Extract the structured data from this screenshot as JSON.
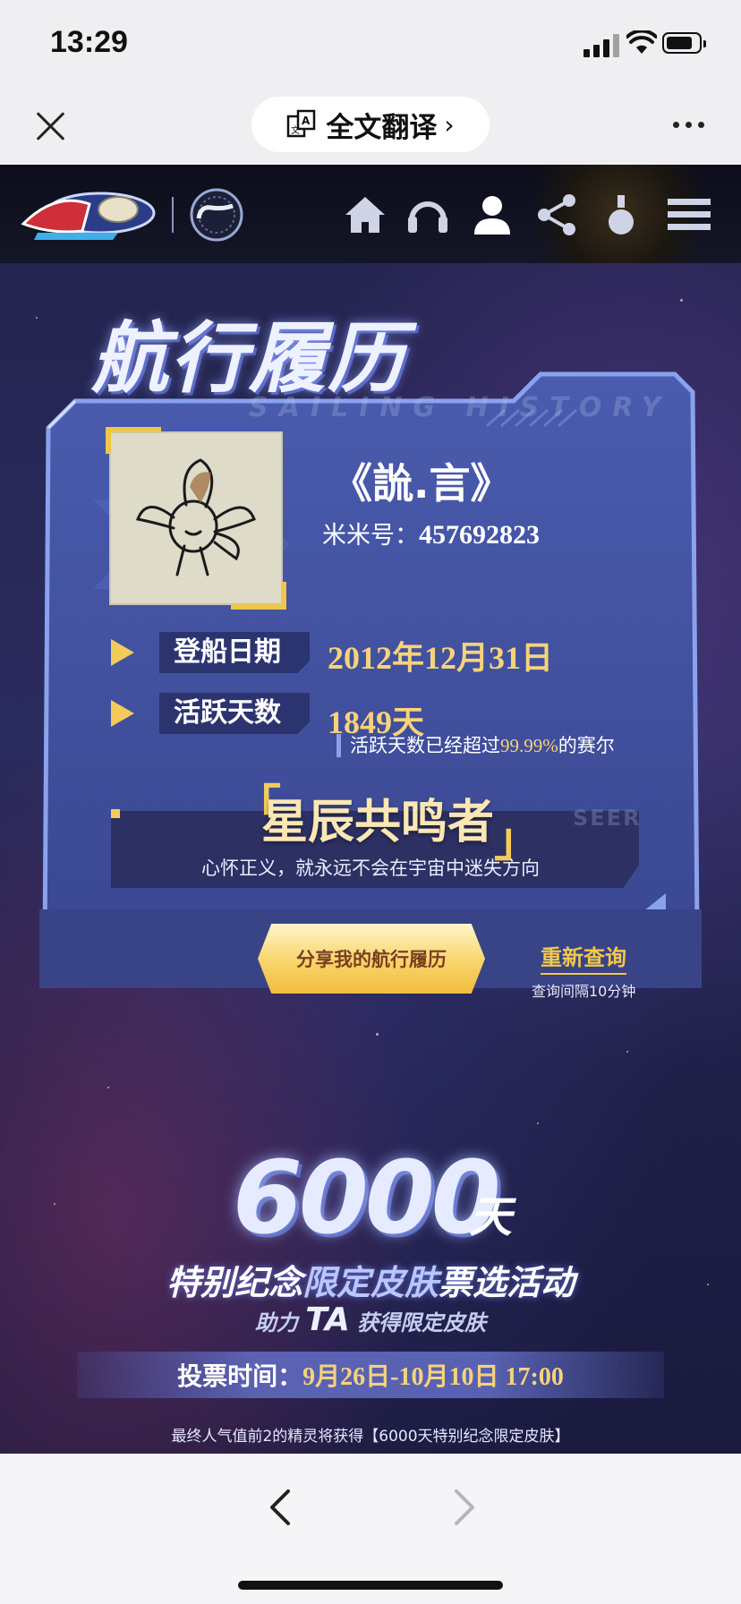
{
  "status": {
    "time": "13:29"
  },
  "browser": {
    "translate_label": "全文翻译",
    "translate_chevron": "›"
  },
  "game_nav": {
    "items": [
      "home-icon",
      "headset-icon",
      "user-icon",
      "share-icon",
      "pot-icon",
      "menu-icon"
    ]
  },
  "profile": {
    "heading": "航行履历",
    "heading_en": "SAILING HISTORY",
    "username": "《詤.言》",
    "id_label": "米米号：",
    "id_value": "457692823",
    "boarding_label": "登船日期",
    "boarding_date": "2012年12月31日",
    "active_label": "活跃天数",
    "active_days": "1849天",
    "active_note_pre": "活跃天数已经超过",
    "active_note_pct": "99.99%",
    "active_note_post": "的赛尔",
    "title_bracket_l": "「",
    "title_bracket_r": "」",
    "honor_title": "星辰共鸣者",
    "seer_watermark": "SEER",
    "motto": "心怀正义，就永远不会在宇宙中迷失方向",
    "share_button": "分享我的航行履历",
    "requery_button": "重新查询",
    "requery_note": "查询间隔10分钟"
  },
  "promo": {
    "big_number": "6000",
    "big_unit": "天",
    "line1_a": "特别纪念",
    "line1_hl": "限定皮肤",
    "line1_b": "票选活动",
    "line2_a": "助力",
    "line2_ta": "TA",
    "line2_b": "获得限定皮肤",
    "vote_label": "投票时间：",
    "vote_time": "9月26日-10月10日 17:00",
    "note": "最终人气值前2的精灵将获得【6000天特别纪念限定皮肤】"
  },
  "colors": {
    "gold": "#f6d37a",
    "panel": "#3c4a95",
    "background": "#23244f"
  }
}
